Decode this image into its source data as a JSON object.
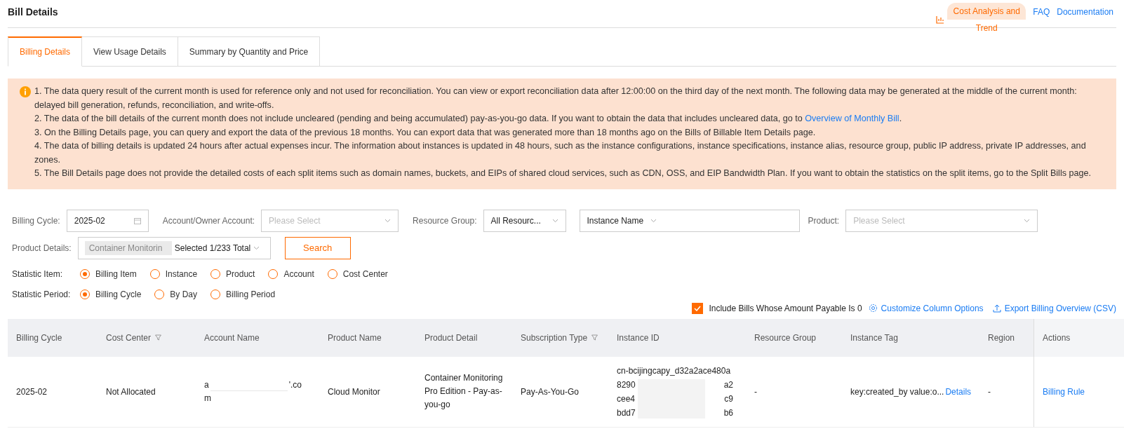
{
  "page": {
    "title": "Bill Details"
  },
  "header_links": [
    {
      "kind": "highlight",
      "label": "Cost Analysis and Trend"
    },
    {
      "kind": "link",
      "label": "FAQ"
    },
    {
      "kind": "link",
      "label": "Documentation"
    }
  ],
  "tabs": [
    {
      "label": "Billing Details",
      "selected": true
    },
    {
      "label": "View Usage Details",
      "selected": false
    },
    {
      "label": "Summary by Quantity and Price",
      "selected": false
    }
  ],
  "notice": {
    "lines": [
      {
        "text": "1. The data query result of the current month is used for reference only and not used for reconciliation. You can view or export reconciliation data after 12:00:00 on the third day of the next month. The following data may be generated at the middle of the current month: delayed bill generation, refunds, reconciliation, and write-offs."
      },
      {
        "text": "2. The data of the bill details of the current month does not include uncleared (pending and being accumulated) pay-as-you-go data. If you want to obtain the data that includes uncleared data, go to ",
        "link": "Overview of Monthly Bill",
        "after": "."
      },
      {
        "text": "3. On the Billing Details page, you can query and export the data of the previous 18 months. You can export data that was generated more than 18 months ago on the Bills of Billable Item Details page."
      },
      {
        "text": "4. The data of billing details is updated 24 hours after actual expenses incur. The information about instances is updated in 48 hours, such as the instance configurations, instance specifications, instance alias, resource group, public IP address, private IP addresses, and zones."
      },
      {
        "text": "5. The Bill Details page does not provide the detailed costs of each split items such as domain names, buckets, and EIPs of shared cloud services, such as CDN, OSS, and EIP Bandwidth Plan. If you want to obtain the statistics on the split items, go to the Split Bills page."
      }
    ]
  },
  "filters": {
    "billing_cycle": {
      "label": "Billing Cycle:",
      "value": "2025-02"
    },
    "account": {
      "label": "Account/Owner Account:",
      "placeholder": "Please Select"
    },
    "resource_group": {
      "label": "Resource Group:",
      "value": "All Resourc..."
    },
    "instance_filter": {
      "value": "Instance Name"
    },
    "product": {
      "label": "Product:",
      "placeholder": "Please Select"
    },
    "product_details": {
      "label": "Product Details:",
      "tag": "Container Monitorin",
      "summary": "Selected 1/233 Total"
    },
    "search_button": "Search"
  },
  "statistic_item": {
    "label": "Statistic Item:",
    "options": [
      {
        "label": "Billing Item",
        "selected": true
      },
      {
        "label": "Instance",
        "selected": false
      },
      {
        "label": "Product",
        "selected": false
      },
      {
        "label": "Account",
        "selected": false
      },
      {
        "label": "Cost Center",
        "selected": false
      }
    ]
  },
  "statistic_period": {
    "label": "Statistic Period:",
    "options": [
      {
        "label": "Billing Cycle",
        "selected": true
      },
      {
        "label": "By Day",
        "selected": false
      },
      {
        "label": "Billing Period",
        "selected": false
      }
    ]
  },
  "toolbar": {
    "include_zero": {
      "label": "Include Bills Whose Amount Payable Is 0",
      "checked": true
    },
    "customize": "Customize Column Options",
    "export": "Export Billing Overview (CSV)"
  },
  "table": {
    "columns": [
      {
        "label": "Billing Cycle",
        "filter": false
      },
      {
        "label": "Cost Center",
        "filter": true
      },
      {
        "label": "Account Name",
        "filter": false
      },
      {
        "label": "Product Name",
        "filter": false
      },
      {
        "label": "Product Detail",
        "filter": false
      },
      {
        "label": "Subscription Type",
        "filter": true
      },
      {
        "label": "Instance ID",
        "filter": false
      },
      {
        "label": "Resource Group",
        "filter": false
      },
      {
        "label": "Instance Tag",
        "filter": false
      },
      {
        "label": "Region",
        "filter": false
      },
      {
        "label": "Actions",
        "filter": false
      }
    ],
    "rows": [
      {
        "billing_cycle": "2025-02",
        "cost_center": "Not Allocated",
        "account_name": [
          "a",
          "'.co",
          "m"
        ],
        "product_name": "Cloud Monitor",
        "product_detail": "Container Monitoring Pro Edition - Pay-as-you-go",
        "subscription_type": "Pay-As-You-Go",
        "instance_id": [
          [
            "cn-bcijingcapy_d32a2ace480a"
          ],
          [
            "8290",
            "a2"
          ],
          [
            "cee4",
            "c9"
          ],
          [
            "bdd7",
            "b6"
          ]
        ],
        "resource_group": "-",
        "instance_tag": "key:created_by value:o...",
        "tag_link": "Details",
        "region": "-",
        "action": "Billing Rule"
      }
    ]
  }
}
